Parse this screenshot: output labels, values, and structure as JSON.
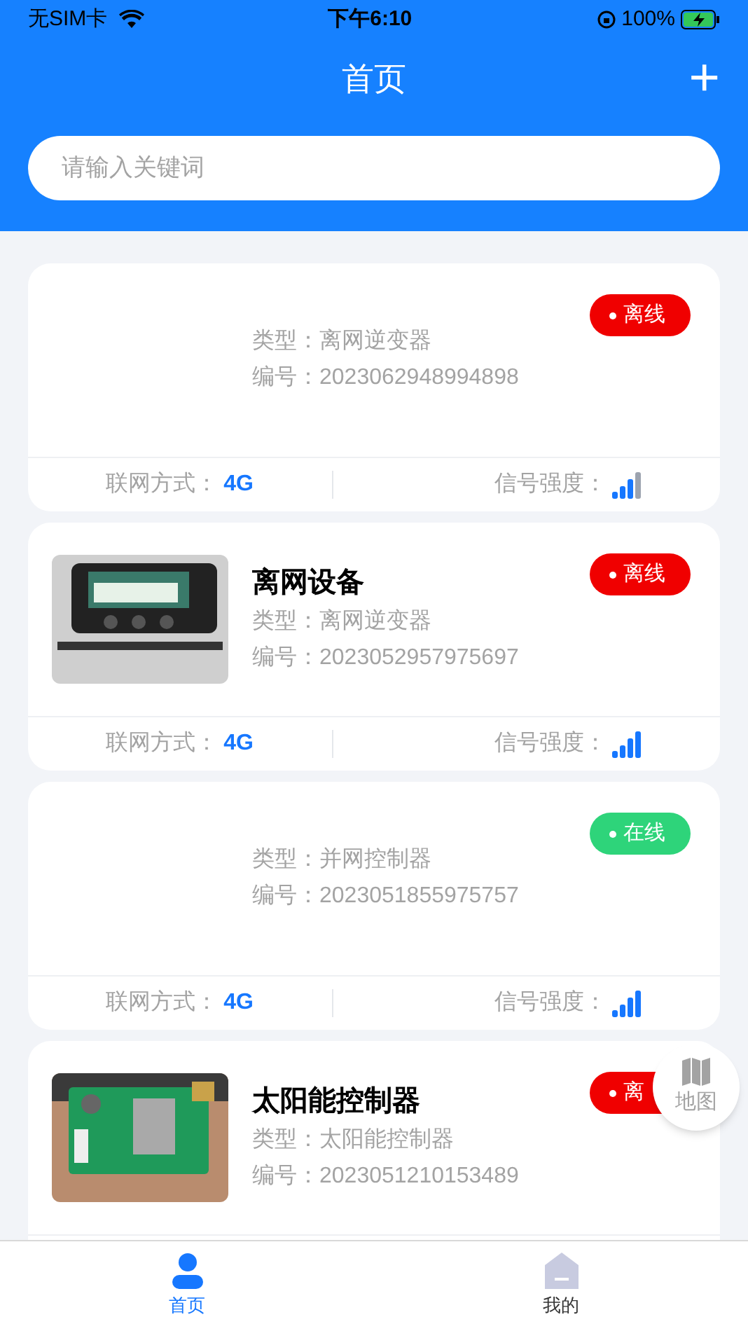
{
  "status_bar": {
    "carrier": "无SIM卡",
    "time": "下午6:10",
    "battery": "100%"
  },
  "header": {
    "title": "首页",
    "add": "+"
  },
  "search": {
    "placeholder": "请输入关键词"
  },
  "devices": [
    {
      "has_picture": false,
      "type_label": "类型：",
      "type": "离网逆变器",
      "id_label": "编号：",
      "id": "2023062948994898",
      "status": {
        "text": "离线",
        "online": false
      },
      "network_label": "联网方式：",
      "network": "4G",
      "signal_label": "信号强度：",
      "signal_full": false
    },
    {
      "has_picture": true,
      "name": "离网设备",
      "type_label": "类型：",
      "type": "离网逆变器",
      "id_label": "编号：",
      "id": "2023052957975697",
      "status": {
        "text": "离线",
        "online": false
      },
      "network_label": "联网方式：",
      "network": "4G",
      "signal_label": "信号强度：",
      "signal_full": true
    },
    {
      "has_picture": false,
      "type_label": "类型：",
      "type": "并网控制器",
      "id_label": "编号：",
      "id": "2023051855975757",
      "status": {
        "text": "在线",
        "online": true
      },
      "network_label": "联网方式：",
      "network": "4G",
      "signal_label": "信号强度：",
      "signal_full": true
    },
    {
      "has_picture": true,
      "name": "太阳能控制器",
      "type_label": "类型：",
      "type": "太阳能控制器",
      "id_label": "编号：",
      "id": "2023051210153489",
      "status": {
        "text": "离",
        "online": false
      }
    }
  ],
  "map_button": {
    "label": "地图"
  },
  "tabs": [
    {
      "label": "首页",
      "selected": true,
      "kind": "person"
    },
    {
      "label": "我的",
      "selected": false,
      "kind": "home"
    }
  ]
}
